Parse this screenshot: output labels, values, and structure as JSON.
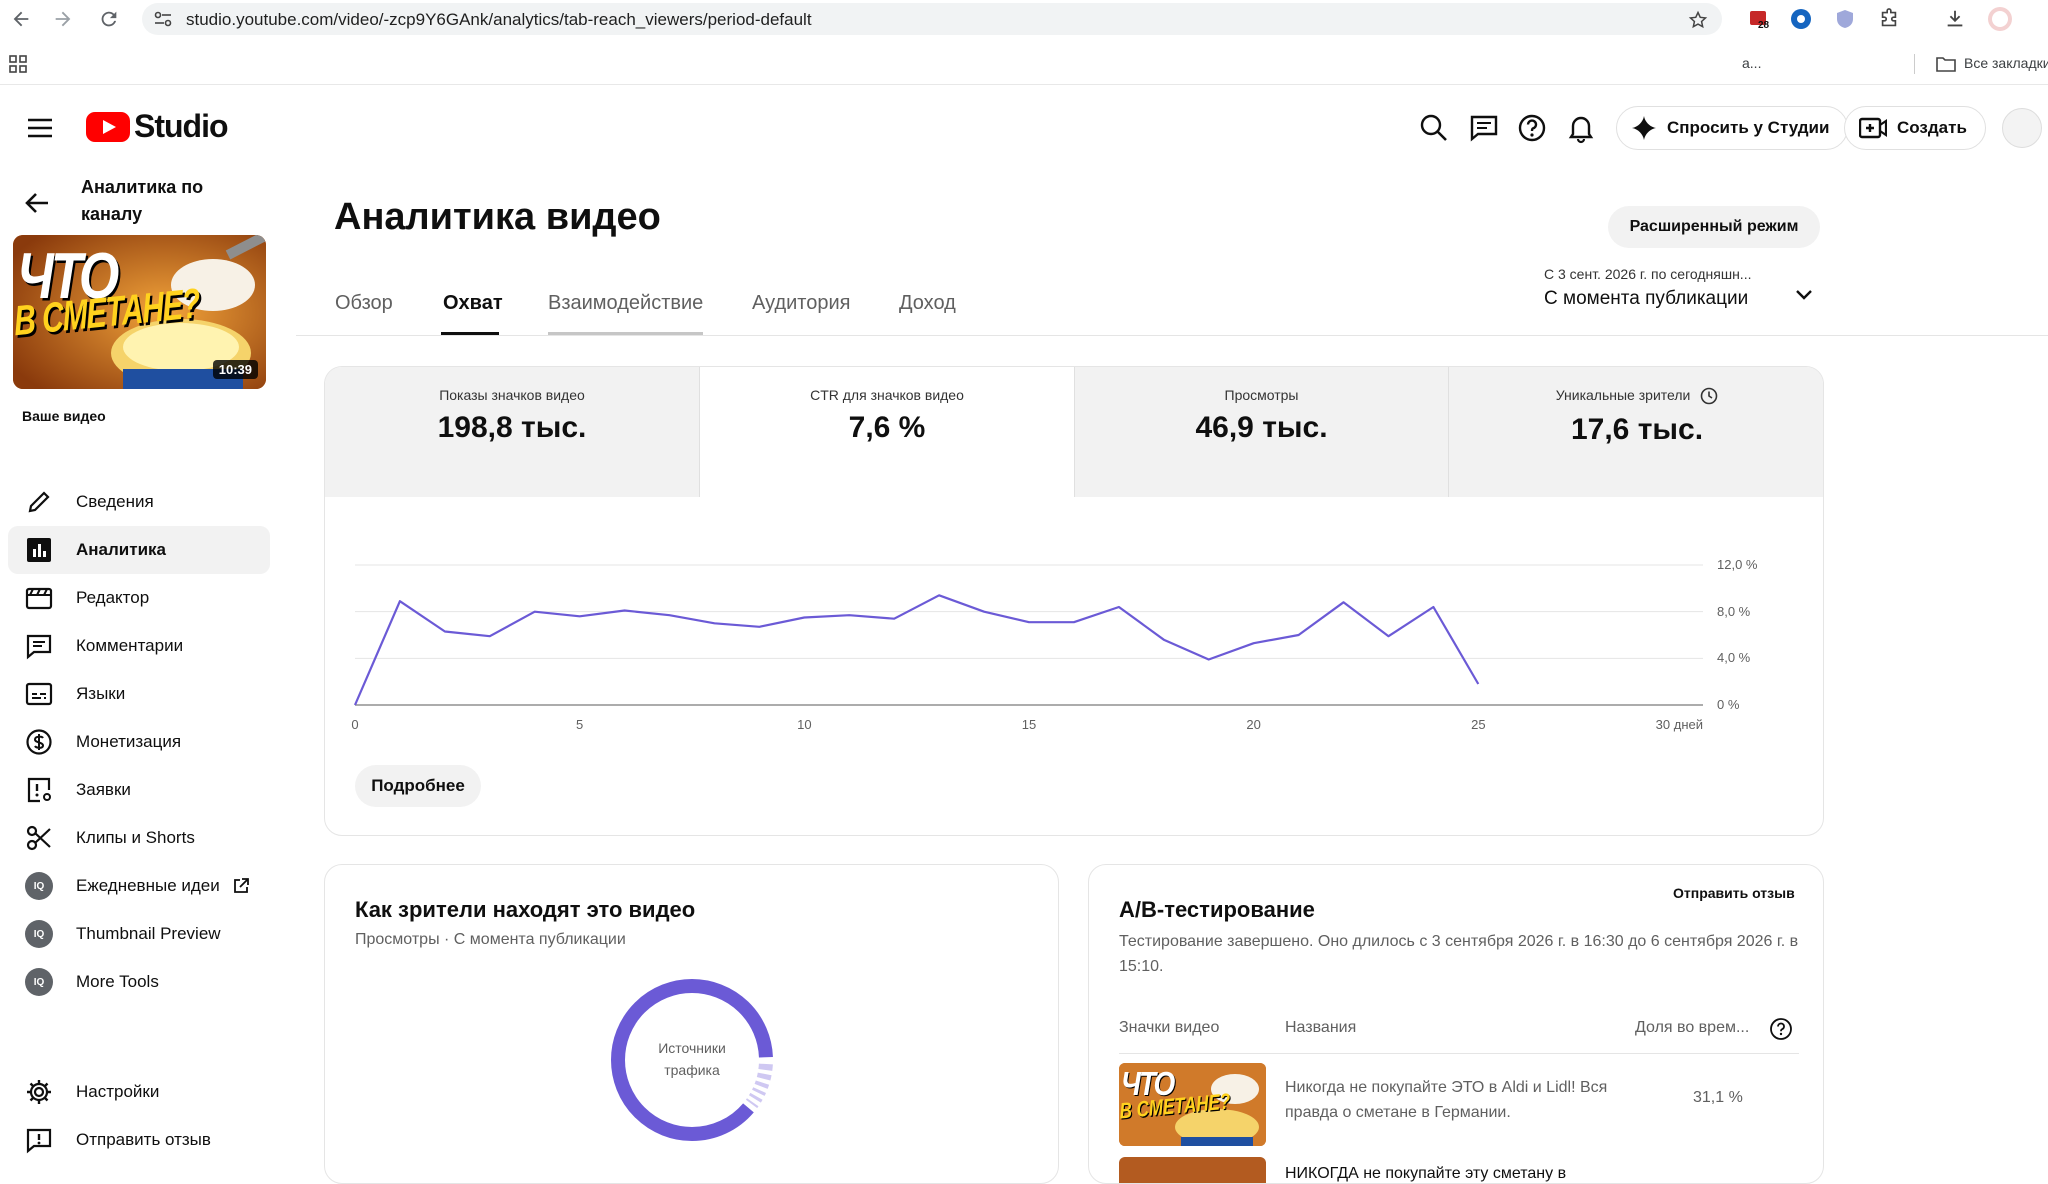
{
  "browser": {
    "url": "studio.youtube.com/video/-zcp9Y6GAnk/analytics/tab-reach_viewers/period-default",
    "ext_badge_count": "28",
    "bookmark_trunc": "а...",
    "all_bookmarks": "Все закладки"
  },
  "header": {
    "logo_text": "Studio",
    "ask_studio": "Спросить у Студии",
    "create": "Создать"
  },
  "sidebar": {
    "back_label": "Аналитика по каналу",
    "thumb_text_line1": "ЧТО",
    "thumb_text_line2": "В СМЕТАНЕ?",
    "duration": "10:39",
    "your_video": "Ваше видео",
    "items": [
      {
        "label": "Сведения",
        "icon": "pencil-icon"
      },
      {
        "label": "Аналитика",
        "icon": "analytics-icon"
      },
      {
        "label": "Редактор",
        "icon": "clapperboard-icon"
      },
      {
        "label": "Комментарии",
        "icon": "comment-icon"
      },
      {
        "label": "Языки",
        "icon": "subtitles-icon"
      },
      {
        "label": "Монетизация",
        "icon": "dollar-icon"
      },
      {
        "label": "Заявки",
        "icon": "claims-icon"
      },
      {
        "label": "Клипы и Shorts",
        "icon": "scissors-icon"
      },
      {
        "label": "Ежедневные идеи",
        "icon": "extension-badge-icon"
      },
      {
        "label": "Thumbnail Preview",
        "icon": "extension-badge-icon"
      },
      {
        "label": "More Tools",
        "icon": "extension-badge-icon"
      }
    ],
    "ext_badge_text": "IQ",
    "settings": "Настройки",
    "feedback": "Отправить отзыв"
  },
  "main": {
    "title": "Аналитика видео",
    "advanced_mode": "Расширенный режим",
    "tabs": [
      "Обзор",
      "Охват",
      "Взаимодействие",
      "Аудитория",
      "Доход"
    ],
    "period_range": "С 3 сент. 2026 г. по сегодняшн...",
    "period_label": "С момента публикации"
  },
  "metrics": [
    {
      "label": "Показы значков видео",
      "value": "198,8 тыс."
    },
    {
      "label": "CTR для значков видео",
      "value": "7,6 %"
    },
    {
      "label": "Просмотры",
      "value": "46,9 тыс."
    },
    {
      "label": "Уникальные зрители",
      "value": "17,6 тыс."
    }
  ],
  "chart_data": {
    "type": "line",
    "x": [
      0,
      1,
      2,
      3,
      4,
      5,
      6,
      7,
      8,
      9,
      10,
      11,
      12,
      13,
      14,
      15,
      16,
      17,
      18,
      19,
      20,
      21,
      22,
      23,
      24,
      25
    ],
    "series": [
      {
        "values": [
          0,
          8.9,
          6.3,
          5.9,
          8.0,
          7.6,
          8.1,
          7.7,
          7.0,
          6.7,
          7.5,
          7.7,
          7.4,
          9.4,
          8.0,
          7.1,
          7.1,
          8.4,
          5.6,
          3.9,
          5.3,
          6.0,
          8.8,
          5.9,
          8.4,
          1.8
        ]
      }
    ],
    "xlim": [
      0,
      30
    ],
    "ylim": [
      0,
      12
    ],
    "x_ticks": [
      "0",
      "5",
      "10",
      "15",
      "20",
      "25",
      "30 дней"
    ],
    "y_ticks": [
      "12,0 %",
      "8,0 %",
      "4,0 %",
      "0 %"
    ],
    "y_tick_values": [
      12,
      8,
      4,
      0
    ],
    "color": "#6b5ad6",
    "grid": true
  },
  "more_button": "Подробнее",
  "traffic": {
    "title": "Как зрители находят это видео",
    "subtitle": "Просмотры · С момента публикации",
    "donut_label": "Источники трафика"
  },
  "ab": {
    "title": "A/B-тестирование",
    "feedback": "Отправить отзыв",
    "description": "Тестирование завершено. Оно длилось с 3 сентября 2026 г. в 16:30 до 6 сентября 2026 г. в 15:10.",
    "col_thumbs": "Значки видео",
    "col_titles": "Названия",
    "col_share": "Доля во врем...",
    "rows": [
      {
        "title": "Никогда не покупайте ЭТО в Aldi и Lidl! Вся правда о сметане в Германии.",
        "share": "31,1 %"
      },
      {
        "title": "НИКОГДА не покупайте эту сметану в",
        "share": ""
      }
    ]
  }
}
